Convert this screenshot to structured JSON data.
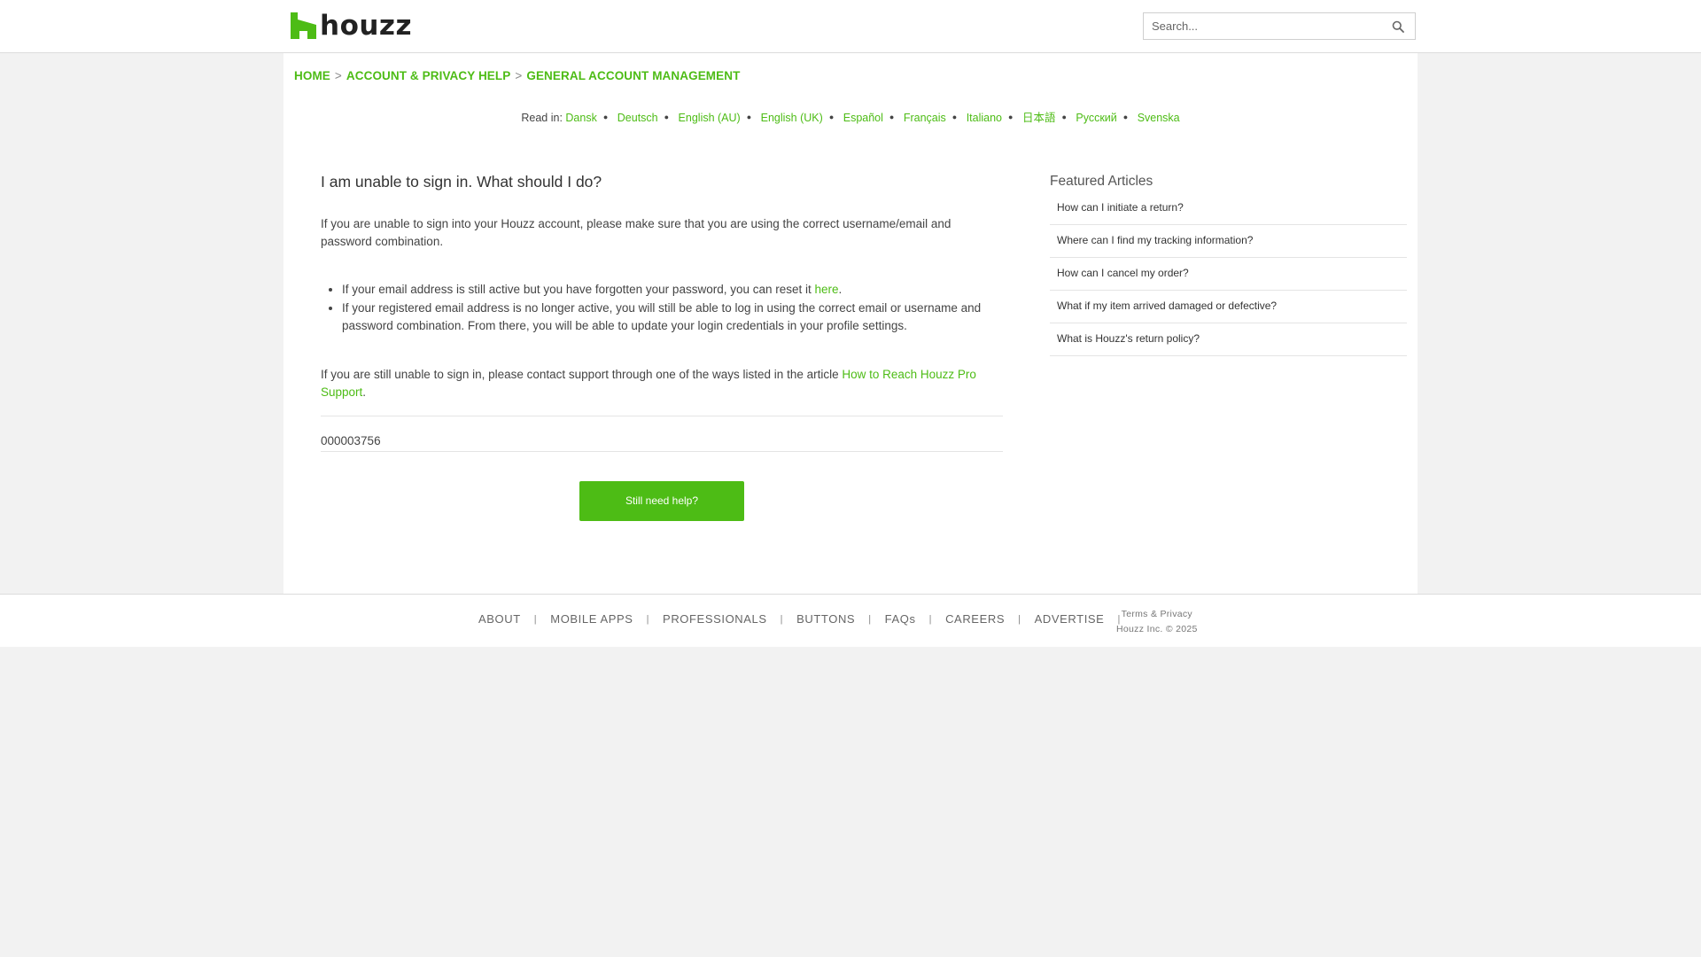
{
  "header": {
    "logo_text": "houzz",
    "search_placeholder": "Search..."
  },
  "breadcrumb": [
    "HOME",
    "ACCOUNT & PRIVACY HELP",
    "GENERAL ACCOUNT MANAGEMENT"
  ],
  "languages": {
    "prefix": "Read in:",
    "items": [
      "Dansk",
      "Deutsch",
      "English (AU)",
      "English (UK)",
      "Español",
      "Français",
      "Italiano",
      "日本語",
      "Русский",
      "Svenska"
    ]
  },
  "article": {
    "title": "I am unable to sign in. What should I do?",
    "intro": "If you are unable to sign into your Houzz account, please make sure that you are using the correct username/email and password combination.",
    "bullet1_text": "If your email address is still active but you have forgotten your password, you can reset it ",
    "bullet1_link": "here",
    "bullet1_end": ".",
    "bullet2": "If your registered email address is no longer active, you will still be able to log in using the correct email or username and password combination. From there, you will be able to update your login credentials in your profile settings.",
    "outro_text": "If you are still unable to sign in, please contact support through one of the ways listed in the article ",
    "outro_link": "How to Reach Houzz Pro Support",
    "outro_end": ".",
    "article_id": "000003756",
    "help_button": "Still need help?"
  },
  "featured": {
    "title": "Featured Articles",
    "items": [
      "How can I initiate a return?",
      "Where can I find my tracking information?",
      "How can I cancel my order?",
      "What if my item arrived damaged or defective?",
      "What is Houzz's return policy?"
    ]
  },
  "footer": {
    "nav": [
      "ABOUT",
      "MOBILE APPS",
      "PROFESSIONALS",
      "BUTTONS",
      "FAQs",
      "CAREERS",
      "ADVERTISE"
    ],
    "terms": "Terms & Privacy",
    "copyright": "Houzz Inc. © 2025"
  },
  "colors": {
    "accent": "#4dbc15",
    "background": "#f2f2f2"
  }
}
